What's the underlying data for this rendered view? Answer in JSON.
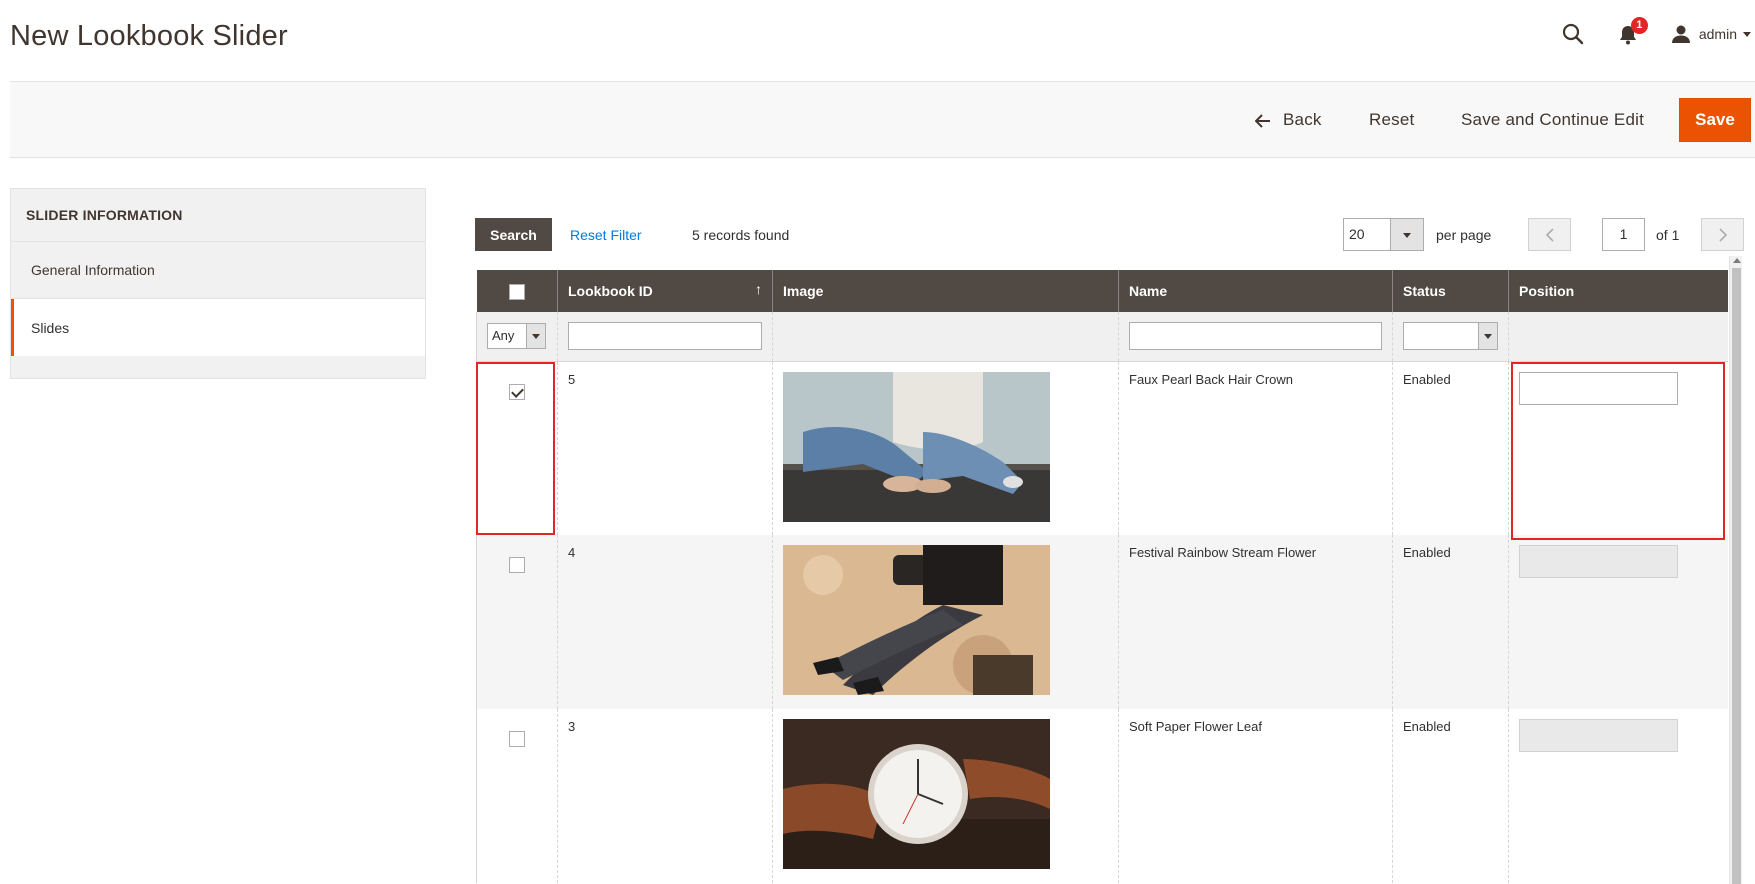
{
  "header": {
    "title": "New Lookbook Slider",
    "notification_count": "1",
    "user_name": "admin"
  },
  "actions": {
    "back": "Back",
    "reset": "Reset",
    "save_continue": "Save and Continue Edit",
    "save": "Save"
  },
  "sidebar": {
    "title": "SLIDER INFORMATION",
    "items": [
      {
        "label": "General Information"
      },
      {
        "label": "Slides"
      }
    ]
  },
  "grid": {
    "search_label": "Search",
    "reset_filter_label": "Reset Filter",
    "records_found": "5 records found",
    "per_page_value": "20",
    "per_page_label": "per page",
    "current_page": "1",
    "of_pages": "of 1",
    "columns": [
      "Lookbook ID",
      "Image",
      "Name",
      "Status",
      "Position"
    ],
    "filter_any": "Any",
    "rows": [
      {
        "id": "5",
        "name": "Faux Pearl Back Hair Crown",
        "status": "Enabled",
        "checked": true,
        "image": "jeans-sweater-photo"
      },
      {
        "id": "4",
        "name": "Festival Rainbow Stream Flower",
        "status": "Enabled",
        "checked": false,
        "image": "boots-sand-photo"
      },
      {
        "id": "3",
        "name": "Soft Paper Flower Leaf",
        "status": "Enabled",
        "checked": false,
        "image": "watch-photo"
      }
    ]
  },
  "colors": {
    "accent": "#eb5202",
    "header_bg": "#514943",
    "link": "#007bdb",
    "highlight": "#e22626"
  }
}
